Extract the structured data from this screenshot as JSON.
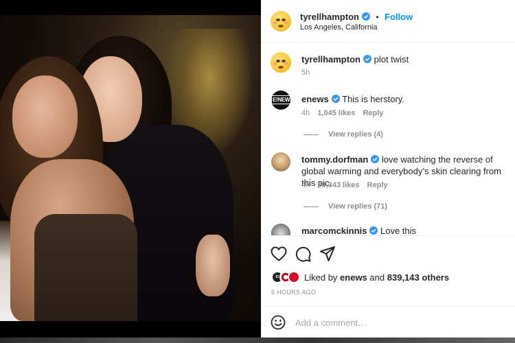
{
  "post": {
    "author": "tyrellhampton",
    "follow_label": "Follow",
    "location": "Los Angeles, California",
    "dot": "•"
  },
  "caption": {
    "username": "tyrellhampton",
    "text": "plot twist",
    "age": "5h"
  },
  "comments": [
    {
      "username": "enews",
      "text": "This is herstory.",
      "age": "4h",
      "likes": "1,045 likes",
      "reply_label": "Reply",
      "view_replies": "View replies (4)",
      "avatar_text": "E!NEWS"
    },
    {
      "username": "tommy.dorfman",
      "text": "love watching the reverse of global warming and everybody’s skin clearing from this pic.",
      "age": "4h",
      "likes": "20,343 likes",
      "reply_label": "Reply",
      "view_replies": "View replies (71)"
    },
    {
      "username": "marcomckinnis",
      "text": "Love this"
    }
  ],
  "likes": {
    "prefix": "Liked by",
    "user": "enews",
    "connector": "and",
    "others": "839,143 others"
  },
  "timestamp": "5 HOURS AGO",
  "add_comment": {
    "placeholder": "Add a comment…"
  },
  "colors": {
    "accent": "#0095f6",
    "verified": "#3897f0",
    "text": "#262626",
    "muted": "#8e8e8e"
  },
  "icons": [
    "heart-icon",
    "comment-icon",
    "share-icon",
    "emoji-icon",
    "verified-icon"
  ]
}
